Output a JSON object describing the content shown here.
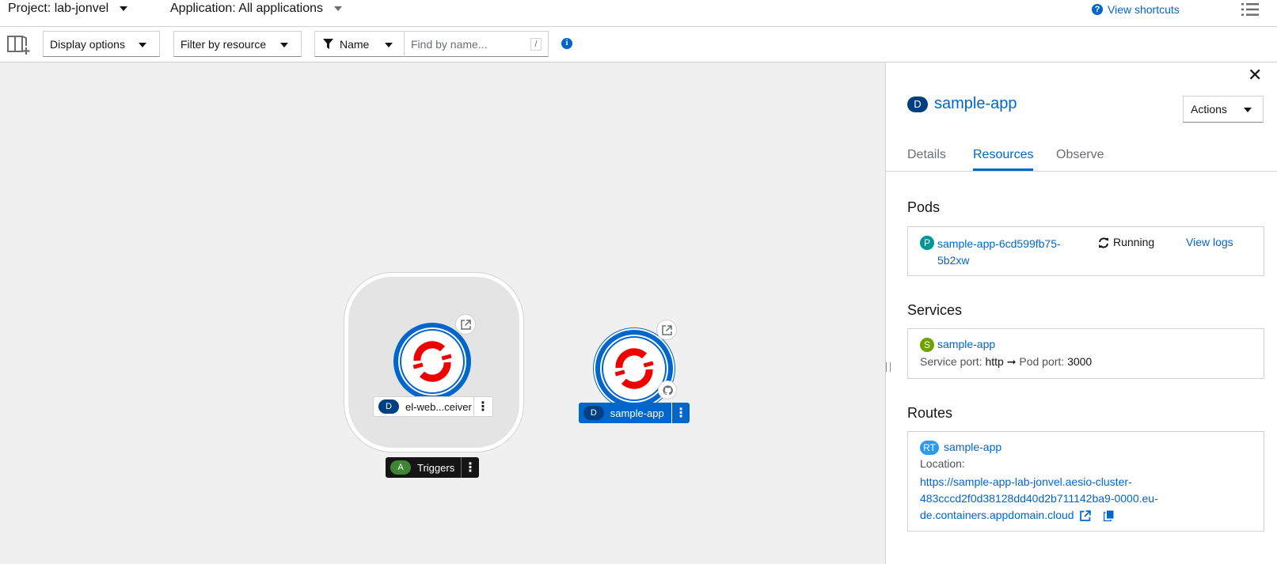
{
  "topbar": {
    "project_label": "Project: lab-jonvel",
    "application_label": "Application: All applications",
    "shortcuts_label": "View shortcuts",
    "shortcuts_icon": "question-circle-icon",
    "list_icon": "list-view-icon"
  },
  "toolbar": {
    "add_icon": "add-to-project-icon",
    "display_options": "Display options",
    "filter_by_resource": "Filter by resource",
    "filter_name": "Name",
    "search_placeholder": "Find by name...",
    "search_shortcut": "/",
    "info_icon": "info-circle-icon"
  },
  "topology": {
    "group": {
      "node_label": "el-web...ceiver",
      "node_badge": "D",
      "app_label": "Triggers",
      "app_badge": "A"
    },
    "node": {
      "label": "sample-app",
      "badge": "D"
    }
  },
  "panel": {
    "badge": "D",
    "title": "sample-app",
    "actions_label": "Actions",
    "tabs": [
      {
        "label": "Details",
        "active": false
      },
      {
        "label": "Resources",
        "active": true
      },
      {
        "label": "Observe",
        "active": false
      }
    ],
    "pods": {
      "heading": "Pods",
      "badge": "P",
      "name_line1": "sample-app-6cd599fb75-",
      "name_line2": "5b2xw",
      "status": "Running",
      "logs_link": "View logs"
    },
    "services": {
      "heading": "Services",
      "badge": "S",
      "name": "sample-app",
      "service_port_label": "Service port:",
      "service_port": "http",
      "arrow": "➞",
      "pod_port_label": "Pod port:",
      "pod_port": "3000"
    },
    "routes": {
      "heading": "Routes",
      "badge": "RT",
      "name": "sample-app",
      "location_label": "Location:",
      "url_line1": "https://sample-app-lab-jonvel.aesio-cluster-",
      "url_line2": "483cccd2f0d38128dd40d2b711142ba9-0000.eu-",
      "url_line3": "de.containers.appdomain.cloud"
    }
  },
  "colors": {
    "link": "#0066cc",
    "deployment_badge": "#004080",
    "app_badge": "#3e8635",
    "pod_badge": "#009596",
    "service_badge": "#6ca100",
    "route_badge": "#2b9af3",
    "openshift_red": "#e00"
  }
}
